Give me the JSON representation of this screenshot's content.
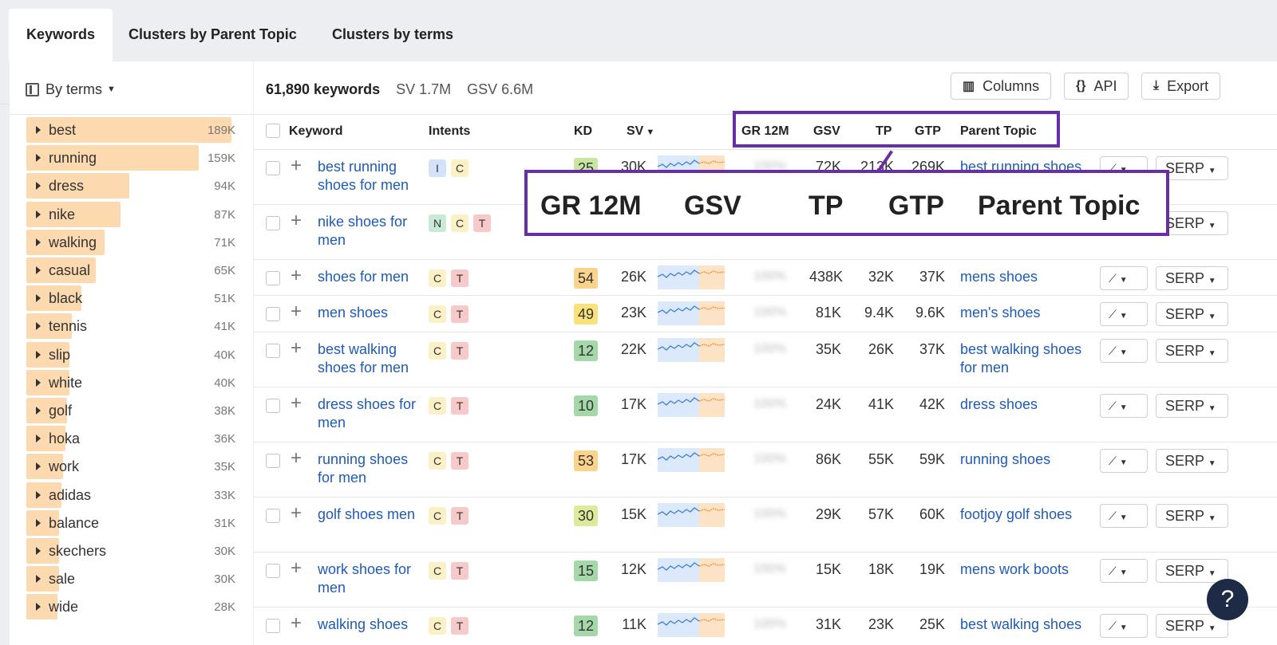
{
  "tabs": [
    {
      "label": "Keywords",
      "active": true
    },
    {
      "label": "Clusters by Parent Topic",
      "active": false
    },
    {
      "label": "Clusters by terms",
      "active": false
    }
  ],
  "sidebar": {
    "group_label": "By terms",
    "terms": [
      {
        "label": "best",
        "count": "189K",
        "share": 1.0
      },
      {
        "label": "running",
        "count": "159K",
        "share": 0.84
      },
      {
        "label": "dress",
        "count": "94K",
        "share": 0.5
      },
      {
        "label": "nike",
        "count": "87K",
        "share": 0.46
      },
      {
        "label": "walking",
        "count": "71K",
        "share": 0.38
      },
      {
        "label": "casual",
        "count": "65K",
        "share": 0.34
      },
      {
        "label": "black",
        "count": "51K",
        "share": 0.27
      },
      {
        "label": "tennis",
        "count": "41K",
        "share": 0.22
      },
      {
        "label": "slip",
        "count": "40K",
        "share": 0.21
      },
      {
        "label": "white",
        "count": "40K",
        "share": 0.21
      },
      {
        "label": "golf",
        "count": "38K",
        "share": 0.2
      },
      {
        "label": "hoka",
        "count": "36K",
        "share": 0.19
      },
      {
        "label": "work",
        "count": "35K",
        "share": 0.18
      },
      {
        "label": "adidas",
        "count": "33K",
        "share": 0.17
      },
      {
        "label": "balance",
        "count": "31K",
        "share": 0.16
      },
      {
        "label": "skechers",
        "count": "30K",
        "share": 0.16
      },
      {
        "label": "sale",
        "count": "30K",
        "share": 0.16
      },
      {
        "label": "wide",
        "count": "28K",
        "share": 0.15
      }
    ]
  },
  "summary": {
    "keywords": "61,890 keywords",
    "sv": "SV 1.7M",
    "gsv": "GSV 6.6M"
  },
  "toolbar": {
    "columns": "Columns",
    "api": "API",
    "export": "Export"
  },
  "columns": {
    "keyword": "Keyword",
    "intents": "Intents",
    "kd": "KD",
    "sv": "SV",
    "gr": "GR 12M",
    "gsv": "GSV",
    "tp": "TP",
    "gtp": "GTP",
    "parent_topic": "Parent Topic"
  },
  "rows": [
    {
      "keyword": "best running shoes for men",
      "intents": [
        "I",
        "C"
      ],
      "kd": "25",
      "kd_color": "#c8e6a0",
      "sv": "30K",
      "gr": "100%",
      "gsv": "72K",
      "tp": "213K",
      "gtp": "269K",
      "parent_topic": "best running shoes",
      "serp": "SERP"
    },
    {
      "keyword": "nike shoes for men",
      "intents": [
        "N",
        "C",
        "T"
      ],
      "kd": "",
      "kd_color": "",
      "sv": "",
      "gr": "",
      "gsv": "",
      "tp": "",
      "gtp": "",
      "parent_topic": "",
      "serp": "SERP"
    },
    {
      "keyword": "shoes for men",
      "intents": [
        "C",
        "T"
      ],
      "kd": "54",
      "kd_color": "#fcd38b",
      "sv": "26K",
      "gr": "100%",
      "gsv": "438K",
      "tp": "32K",
      "gtp": "37K",
      "parent_topic": "mens shoes",
      "serp": "SERP"
    },
    {
      "keyword": "men shoes",
      "intents": [
        "C",
        "T"
      ],
      "kd": "49",
      "kd_color": "#f9e27a",
      "sv": "23K",
      "gr": "100%",
      "gsv": "81K",
      "tp": "9.4K",
      "gtp": "9.6K",
      "parent_topic": "men's shoes",
      "serp": "SERP"
    },
    {
      "keyword": "best walking shoes for men",
      "intents": [
        "C",
        "T"
      ],
      "kd": "12",
      "kd_color": "#a5d8a9",
      "sv": "22K",
      "gr": "100%",
      "gsv": "35K",
      "tp": "26K",
      "gtp": "37K",
      "parent_topic": "best walking shoes for men",
      "serp": "SERP"
    },
    {
      "keyword": "dress shoes for men",
      "intents": [
        "C",
        "T"
      ],
      "kd": "10",
      "kd_color": "#a5d8a9",
      "sv": "17K",
      "gr": "100%",
      "gsv": "24K",
      "tp": "41K",
      "gtp": "42K",
      "parent_topic": "dress shoes",
      "serp": "SERP"
    },
    {
      "keyword": "running shoes for men",
      "intents": [
        "C",
        "T"
      ],
      "kd": "53",
      "kd_color": "#fcd38b",
      "sv": "17K",
      "gr": "100%",
      "gsv": "86K",
      "tp": "55K",
      "gtp": "59K",
      "parent_topic": "running shoes",
      "serp": "SERP"
    },
    {
      "keyword": "golf shoes men",
      "intents": [
        "C",
        "T"
      ],
      "kd": "30",
      "kd_color": "#dcea9a",
      "sv": "15K",
      "gr": "100%",
      "gsv": "29K",
      "tp": "57K",
      "gtp": "60K",
      "parent_topic": "footjoy golf shoes",
      "serp": "SERP"
    },
    {
      "keyword": "work shoes for men",
      "intents": [
        "C",
        "T"
      ],
      "kd": "15",
      "kd_color": "#a5d8a9",
      "sv": "12K",
      "gr": "100%",
      "gsv": "15K",
      "tp": "18K",
      "gtp": "19K",
      "parent_topic": "mens work boots",
      "serp": "SERP"
    },
    {
      "keyword": "walking shoes",
      "intents": [
        "C",
        "T"
      ],
      "kd": "12",
      "kd_color": "#a5d8a9",
      "sv": "11K",
      "gr": "100%",
      "gsv": "31K",
      "tp": "23K",
      "gtp": "25K",
      "parent_topic": "best walking shoes",
      "serp": "SERP"
    }
  ],
  "zoom_callout": {
    "gr": "GR 12M",
    "gsv": "GSV",
    "tp": "TP",
    "gtp": "GTP",
    "parent_topic": "Parent Topic"
  },
  "help": {
    "label": "?"
  }
}
